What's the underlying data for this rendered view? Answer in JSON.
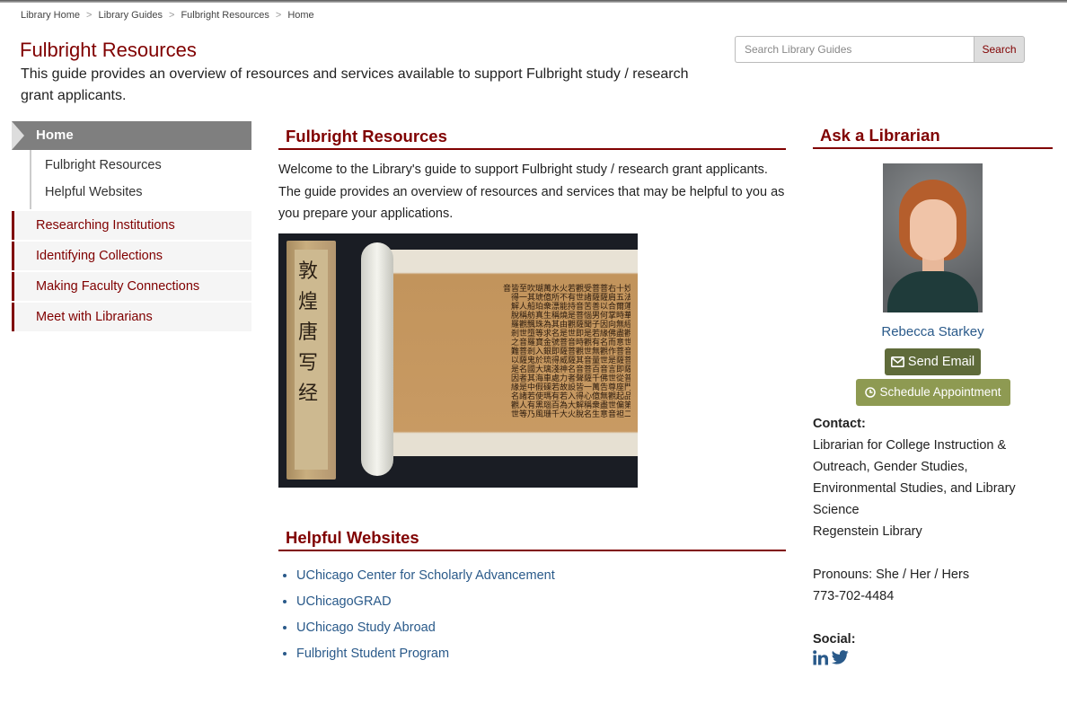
{
  "breadcrumb": [
    "Library Home",
    "Library Guides",
    "Fulbright Resources",
    "Home"
  ],
  "breadcrumb_sep": ">",
  "guide": {
    "title": "Fulbright Resources",
    "description": "This guide provides an overview of resources and services available to support Fulbright study / research grant applicants."
  },
  "search": {
    "placeholder": "Search Library Guides",
    "button": "Search"
  },
  "nav": {
    "home": "Home",
    "sub": [
      "Fulbright Resources",
      "Helpful Websites"
    ],
    "items": [
      "Researching Institutions",
      "Identifying Collections",
      "Making Faculty Connections",
      "Meet with Librarians"
    ]
  },
  "main": {
    "resources_heading": "Fulbright Resources",
    "welcome": "Welcome to the Library's guide to support Fulbright study / research grant applicants. The guide provides an overview of resources and services that may be helpful to you as you prepare your applications.",
    "scroll_box_chars": "敦煌唐写经",
    "scroll_text": "妙法蓮華經觀世音菩薩普門品第二十五爾時無盡意菩薩即從座起偏袒右肩合掌向佛而作是言世尊觀世音菩薩以何因緣名觀世音佛告無盡意菩薩善男子若有無量百千萬億衆生受諸苦惱聞是觀世音菩薩一心稱名觀世音菩薩即時觀其音聲皆得解脫若有持是觀世音菩薩名者設入大火火不能燒由是菩薩威神力故若為大水所漂稱其名號即得淺處若有百千萬億衆生為求金銀琉璃車磲瑪瑙珊瑚琥珀真珠等寶入於大海假使黑風吹其船舫飄墮羅剎鬼國其中若有乃至一人稱觀世音菩薩名者是諸人等皆得解脫羅剎之難以是因緣名觀世音",
    "websites_heading": "Helpful Websites",
    "links": [
      "UChicago Center for Scholarly Advancement",
      "UChicagoGRAD",
      "UChicago Study Abroad",
      "Fulbright Student Program"
    ]
  },
  "sidebar": {
    "heading": "Ask a Librarian",
    "name": "Rebecca Starkey",
    "email_button": "Send Email",
    "schedule_button": "Schedule Appointment",
    "contact_label": "Contact:",
    "title": "Librarian for College Instruction & Outreach, Gender Studies, Environmental Studies, and Library Science",
    "location": "Regenstein Library",
    "pronouns": "Pronouns: She / Her / Hers",
    "phone": "773-702-4484",
    "social_label": "Social:",
    "social_icons": [
      "linkedin-icon",
      "twitter-icon"
    ]
  },
  "colors": {
    "maroon": "#800000",
    "link": "#2a5a8a",
    "email_button": "#5f6b3a",
    "schedule_button": "#8e9a52"
  }
}
